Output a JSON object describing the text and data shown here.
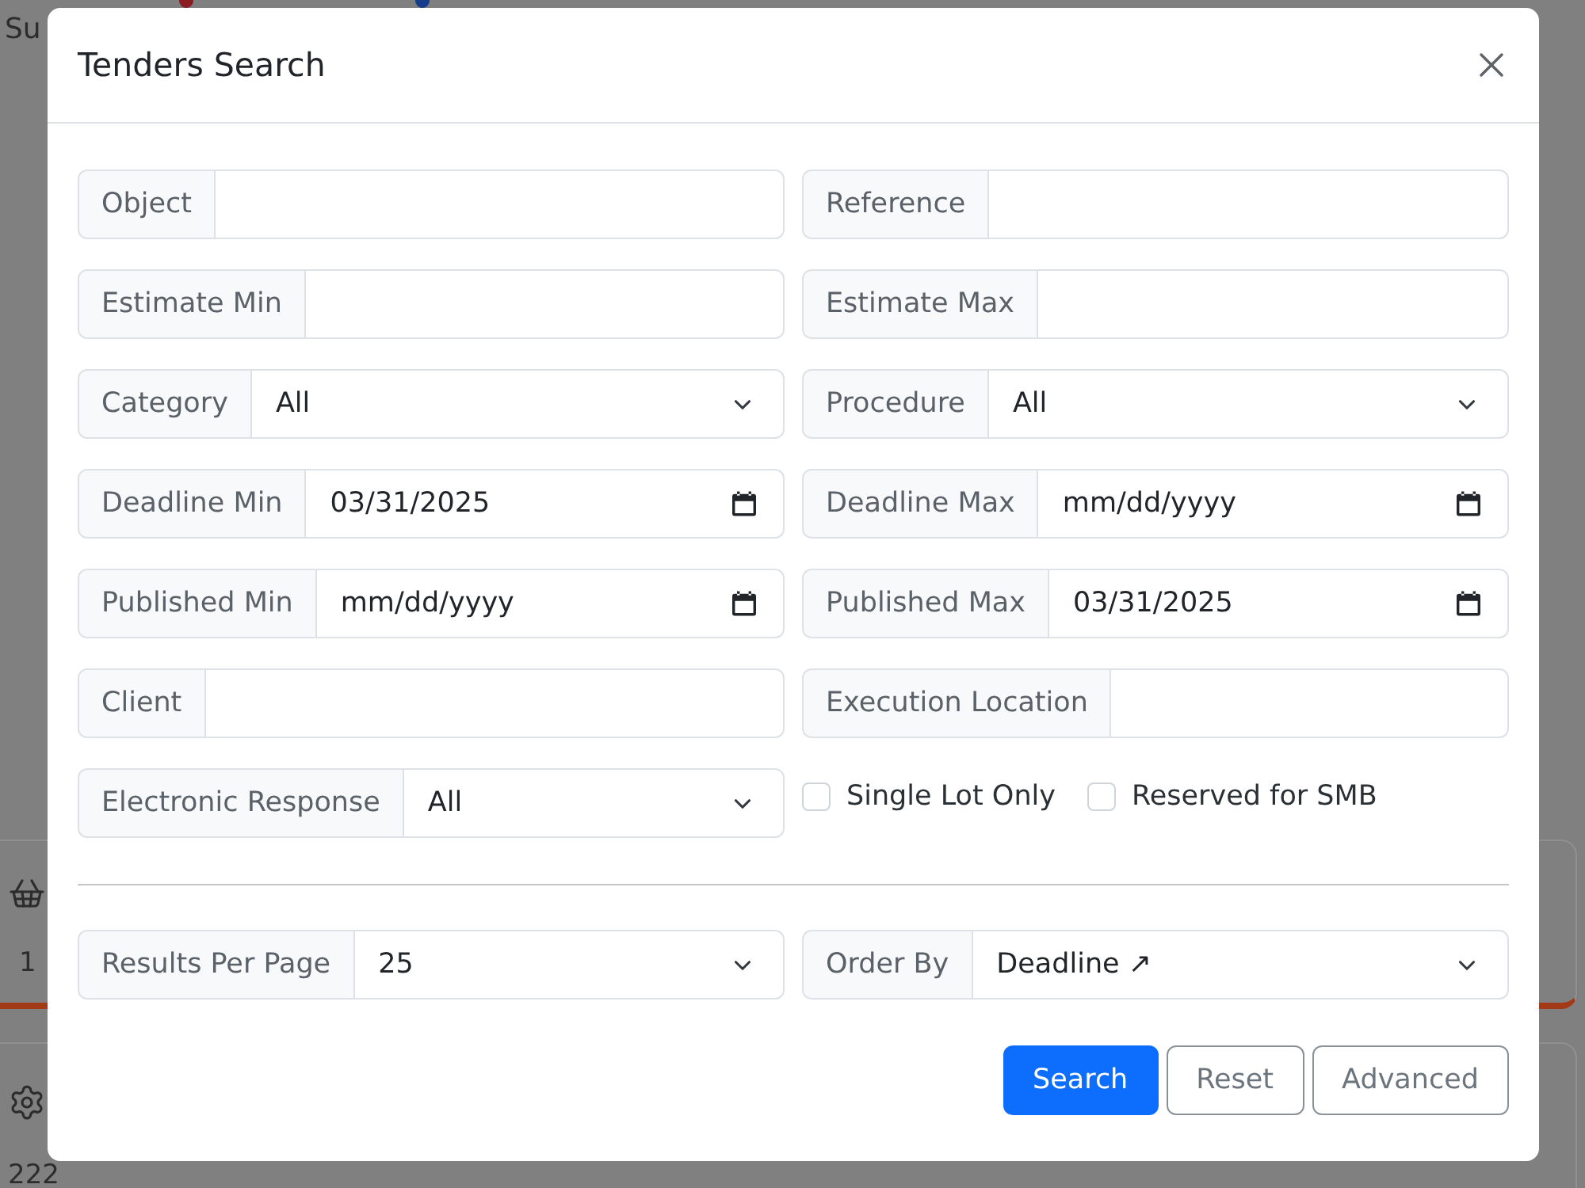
{
  "background": {
    "heading": "Su",
    "markers": [
      {
        "color": "#8c1c24"
      },
      {
        "color": "#163c8c"
      }
    ],
    "cards": [
      {
        "value": "1"
      },
      {
        "value": "222"
      }
    ]
  },
  "dialog": {
    "title": "Tenders Search",
    "fields": [
      {
        "kind": "text",
        "label": "Object"
      },
      {
        "kind": "text",
        "label": "Reference"
      },
      {
        "kind": "text",
        "label": "Estimate Min"
      },
      {
        "kind": "text",
        "label": "Estimate Max"
      },
      {
        "kind": "select",
        "label": "Category",
        "value": "All"
      },
      {
        "kind": "select",
        "label": "Procedure",
        "value": "All"
      },
      {
        "kind": "date",
        "label": "Deadline Min",
        "value": "03/31/2025"
      },
      {
        "kind": "date",
        "label": "Deadline Max",
        "placeholder": "mm/dd/yyyy"
      },
      {
        "kind": "date",
        "label": "Published Min",
        "placeholder": "mm/dd/yyyy"
      },
      {
        "kind": "date",
        "label": "Published Max",
        "value": "03/31/2025"
      },
      {
        "kind": "text",
        "label": "Client"
      },
      {
        "kind": "text",
        "label": "Execution Location"
      },
      {
        "kind": "select",
        "label": "Electronic Response",
        "value": "All"
      }
    ],
    "checkboxes": [
      {
        "label": "Single Lot Only",
        "checked": false
      },
      {
        "label": "Reserved for SMB",
        "checked": false
      }
    ],
    "sort_fields": [
      {
        "kind": "select",
        "label": "Results Per Page",
        "value": "25"
      },
      {
        "kind": "select",
        "label": "Order By",
        "value": "Deadline ↗"
      }
    ],
    "buttons": [
      {
        "kind": "primary",
        "label": "Search"
      },
      {
        "kind": "outline",
        "label": "Reset"
      },
      {
        "kind": "outline",
        "label": "Advanced"
      }
    ]
  }
}
